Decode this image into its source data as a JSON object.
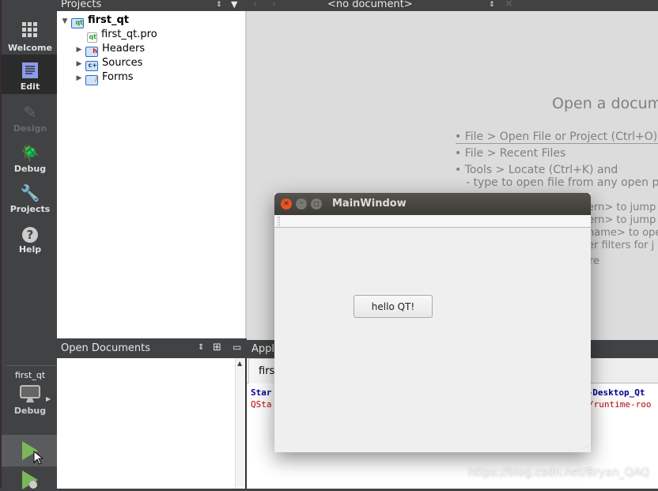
{
  "modebar": {
    "items": [
      {
        "label": "Welcome",
        "icon": "grid-icon"
      },
      {
        "label": "Edit",
        "icon": "document-icon",
        "selected": true
      },
      {
        "label": "Design",
        "icon": "pencil-icon",
        "disabled": true
      },
      {
        "label": "Debug",
        "icon": "bug-icon"
      },
      {
        "label": "Projects",
        "icon": "wrench-icon"
      },
      {
        "label": "Help",
        "icon": "help-icon"
      }
    ],
    "target": {
      "project": "first_qt",
      "build": "Debug"
    }
  },
  "projects": {
    "title": "Projects",
    "tree": {
      "root": "first_qt",
      "children": [
        "first_qt.pro",
        "Headers",
        "Sources",
        "Forms"
      ]
    }
  },
  "open_documents": {
    "title": "Open Documents"
  },
  "editor": {
    "document_selector": "<no document>",
    "welcome_title": "Open a docum",
    "bullets": [
      "• File > Open File or Project (Ctrl+O)",
      "• File > Recent Files",
      "• Tools > Locate (Ctrl+K) and"
    ],
    "sub_lines": [
      "- type to open file from any open p",
      "ern> to jump",
      "ern> to jump",
      "name> to ope",
      "er filters for j",
      "re"
    ]
  },
  "output": {
    "title": "Appli",
    "tab": "first",
    "line1_left": "Star",
    "line1_right": "t-Desktop_Qt",
    "line2_left": "QSta",
    "line2_right": "/runtime-roo"
  },
  "main_window": {
    "title": "MainWindow",
    "button": "hello QT!"
  },
  "watermark": "https://blog.csdn.net/Bryan_QAQ"
}
